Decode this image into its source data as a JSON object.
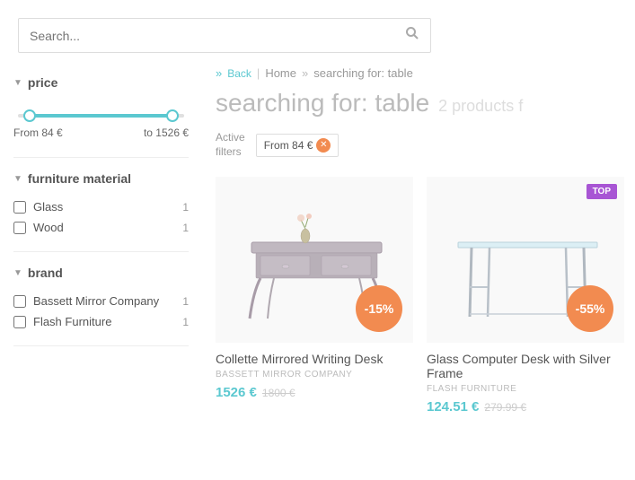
{
  "search": {
    "placeholder": "Search...",
    "value": ""
  },
  "breadcrumb": {
    "back": "Back",
    "separator": "|",
    "home": "Home",
    "arrow": "»",
    "current": "searching for: table"
  },
  "page_title": "searching for: table",
  "product_count": "2 products f",
  "active_filters": {
    "label": "Active\nfilters",
    "tag": "From 84 €"
  },
  "sidebar": {
    "price_section": {
      "title": "price",
      "from": "From 84 €",
      "to": "to 1526 €"
    },
    "material_section": {
      "title": "furniture material",
      "items": [
        {
          "label": "Glass",
          "count": 1
        },
        {
          "label": "Wood",
          "count": 1
        }
      ]
    },
    "brand_section": {
      "title": "brand",
      "items": [
        {
          "label": "Bassett Mirror Company",
          "count": 1
        },
        {
          "label": "Flash Furniture",
          "count": 1
        }
      ]
    }
  },
  "products": [
    {
      "name": "Collette Mirrored Writing Desk",
      "brand": "BASSETT MIRROR COMPANY",
      "price_current": "1526 €",
      "price_original": "1800 €",
      "discount": "-15%",
      "top_badge": null
    },
    {
      "name": "Glass Computer Desk with Silver Frame",
      "brand": "FLASH FURNITURE",
      "price_current": "124.51 €",
      "price_original": "279.99 €",
      "discount": "-55%",
      "top_badge": "TOP"
    }
  ]
}
